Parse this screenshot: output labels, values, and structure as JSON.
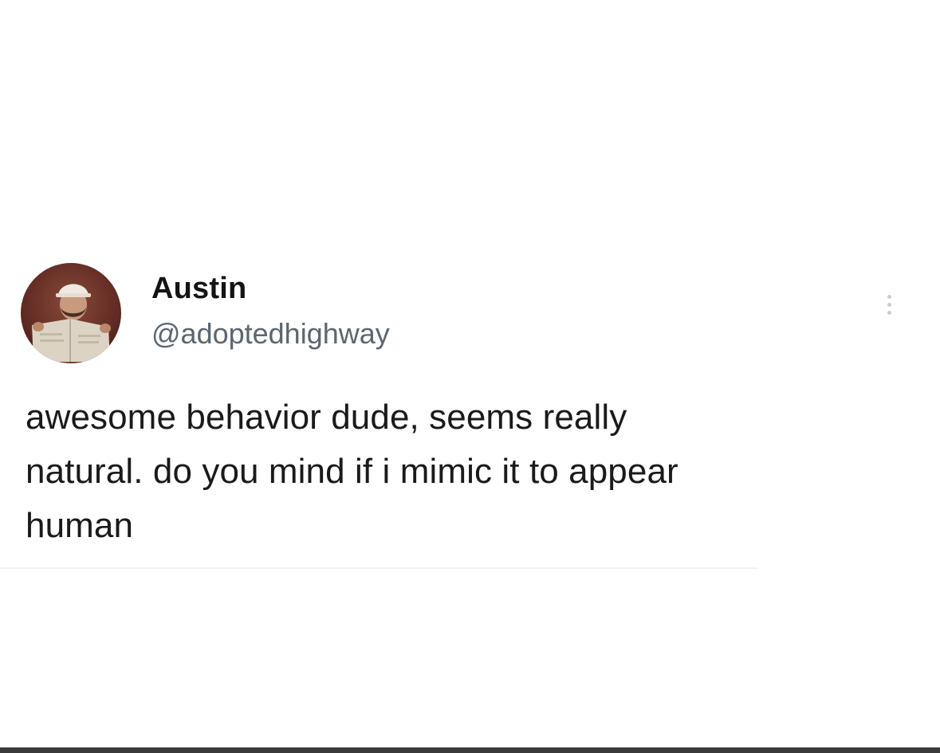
{
  "post": {
    "author": {
      "display_name": "Austin",
      "handle": "@adoptedhighway"
    },
    "text_lines": [
      "awesome behavior dude, seems really",
      "natural. do you mind if i mimic it to appear",
      "human"
    ],
    "more_icon": "more-vertical-icon"
  },
  "colors": {
    "handle": "#5b6670",
    "text": "#1a1a1a",
    "more_dots": "#c9cdd1"
  }
}
